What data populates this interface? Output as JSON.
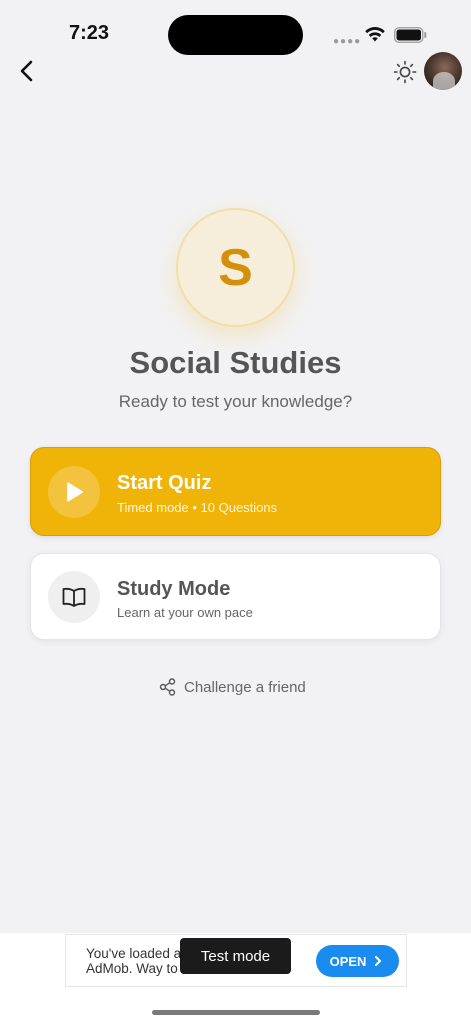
{
  "status_bar": {
    "time": "7:23",
    "signal_icon": "signal-dots-icon",
    "wifi_icon": "wifi-icon",
    "battery_icon": "battery-icon"
  },
  "header": {
    "back_icon": "chevron-left-icon",
    "theme_icon": "sun-icon",
    "avatar": "user-avatar"
  },
  "subject": {
    "letter": "S",
    "title": "Social Studies",
    "subtitle": "Ready to test your knowledge?"
  },
  "actions": [
    {
      "icon": "play-icon",
      "title": "Start Quiz",
      "subtitle": "Timed mode • 10 Questions"
    },
    {
      "icon": "book-open-icon",
      "title": "Study Mode",
      "subtitle": "Learn at your own pace"
    }
  ],
  "challenge": {
    "icon": "share-icon",
    "label": "Challenge a friend"
  },
  "ad": {
    "text_line1": "You've loaded a",
    "text_line2": "AdMob. Way to",
    "open_label": "OPEN",
    "open_icon": "chevron-right-icon",
    "toast": "Test mode"
  },
  "colors": {
    "accent": "#f0b308",
    "subject_letter": "#d4900a",
    "ad_button": "#1a8cf0",
    "background": "#f2f2f4"
  }
}
